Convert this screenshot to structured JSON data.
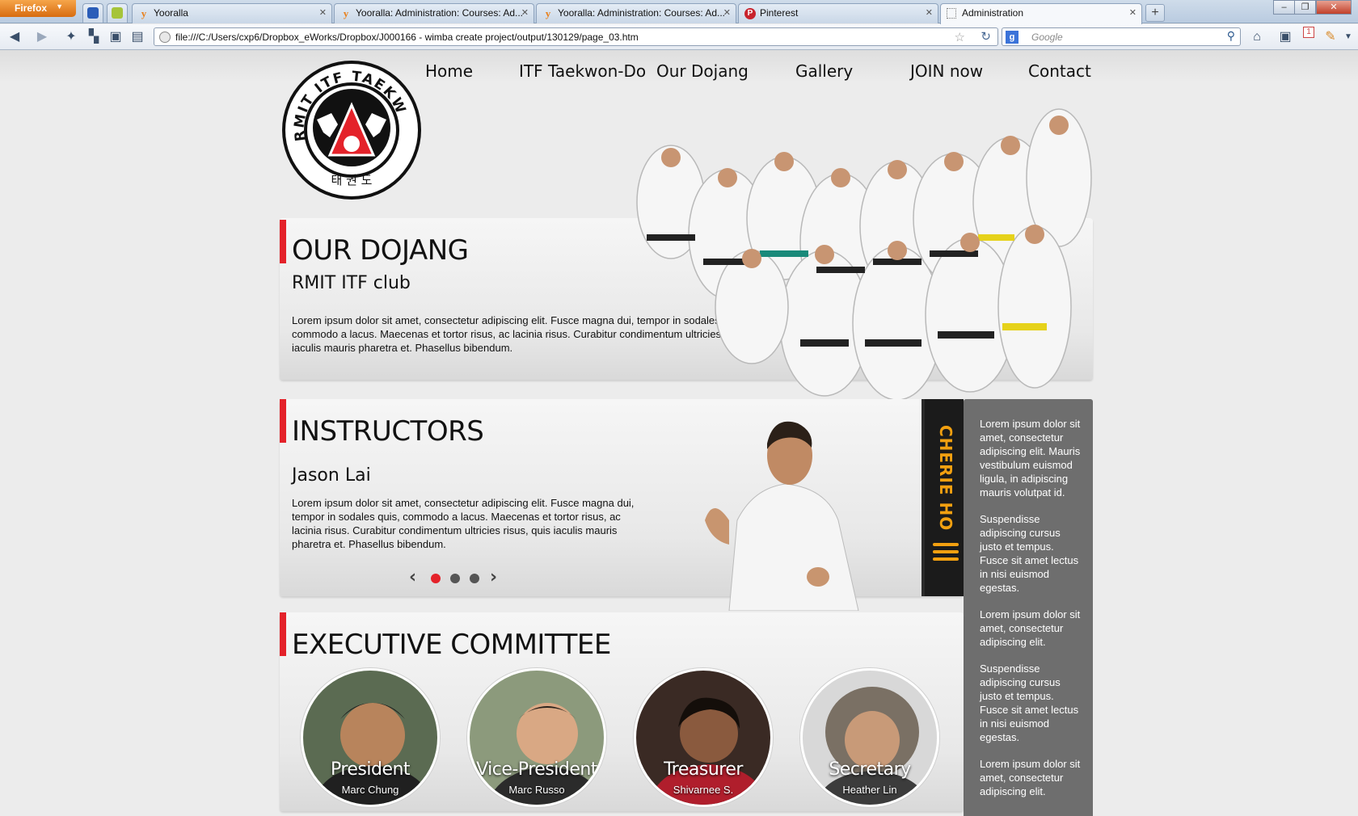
{
  "browser": {
    "menu_button": "Firefox",
    "tabs": [
      {
        "title": "Yooralla"
      },
      {
        "title": "Yooralla: Administration: Courses: Ad..."
      },
      {
        "title": "Yooralla: Administration: Courses: Ad..."
      },
      {
        "title": "Pinterest"
      },
      {
        "title": "Administration"
      }
    ],
    "url": "file:///C:/Users/cxp6/Dropbox_eWorks/Dropbox/J000166 - wimba create project/output/130129/page_03.htm",
    "search_placeholder": "Google",
    "notification_count": "1"
  },
  "site": {
    "nav": [
      "Home",
      "ITF Taekwon-Do",
      "Our Dojang",
      "Gallery",
      "JOIN now",
      "Contact"
    ],
    "logo": {
      "outer_text": "RMIT ITF TAEKWON-DO",
      "korean": "태 권 도"
    },
    "dojang": {
      "heading": "OUR DOJANG",
      "subheading": "RMIT ITF club",
      "text": "Lorem ipsum dolor sit amet, consectetur adipiscing elit. Fusce magna dui, tempor in sodales quis, commodo a lacus. Maecenas et tortor risus, ac lacinia risus. Curabitur condimentum ultricies risus, quis iaculis mauris pharetra et. Phasellus bibendum."
    },
    "instructors": {
      "heading": "INSTRUCTORS",
      "name": "Jason Lai",
      "text": "Lorem ipsum dolor sit amet, consectetur adipiscing elit. Fusce magna dui, tempor in sodales quis, commodo a lacus. Maecenas et tortor risus, ac lacinia risus. Curabitur condimentum ultricies risus, quis iaculis mauris pharetra et. Phasellus bibendum.",
      "belt_name": "CHERIE HO",
      "carousel_active": 1,
      "carousel_count": 3
    },
    "sidebar": [
      "Lorem ipsum dolor sit amet, consectetur adipiscing elit. Mauris vestibulum euismod ligula, in adipiscing mauris volutpat id.",
      "Suspendisse adipiscing cursus justo et tempus. Fusce sit amet lectus in nisi euismod egestas.",
      "Lorem ipsum dolor sit amet, consectetur adipiscing elit.",
      "Suspendisse adipiscing cursus justo et tempus. Fusce sit amet lectus in nisi euismod egestas.",
      "Lorem ipsum dolor sit amet, consectetur adipiscing elit."
    ],
    "committee": {
      "heading": "EXECUTIVE COMMITTEE",
      "members": [
        {
          "role": "President",
          "name": "Marc Chung"
        },
        {
          "role": "Vice-President",
          "name": "Marc Russo"
        },
        {
          "role": "Treasurer",
          "name": "Shivarnee S."
        },
        {
          "role": "Secretary",
          "name": "Heather Lin"
        }
      ]
    }
  },
  "colors": {
    "accent_red": "#e4222a",
    "belt_gold": "#f2a010",
    "sidebar_bg": "#6e6e6e"
  }
}
